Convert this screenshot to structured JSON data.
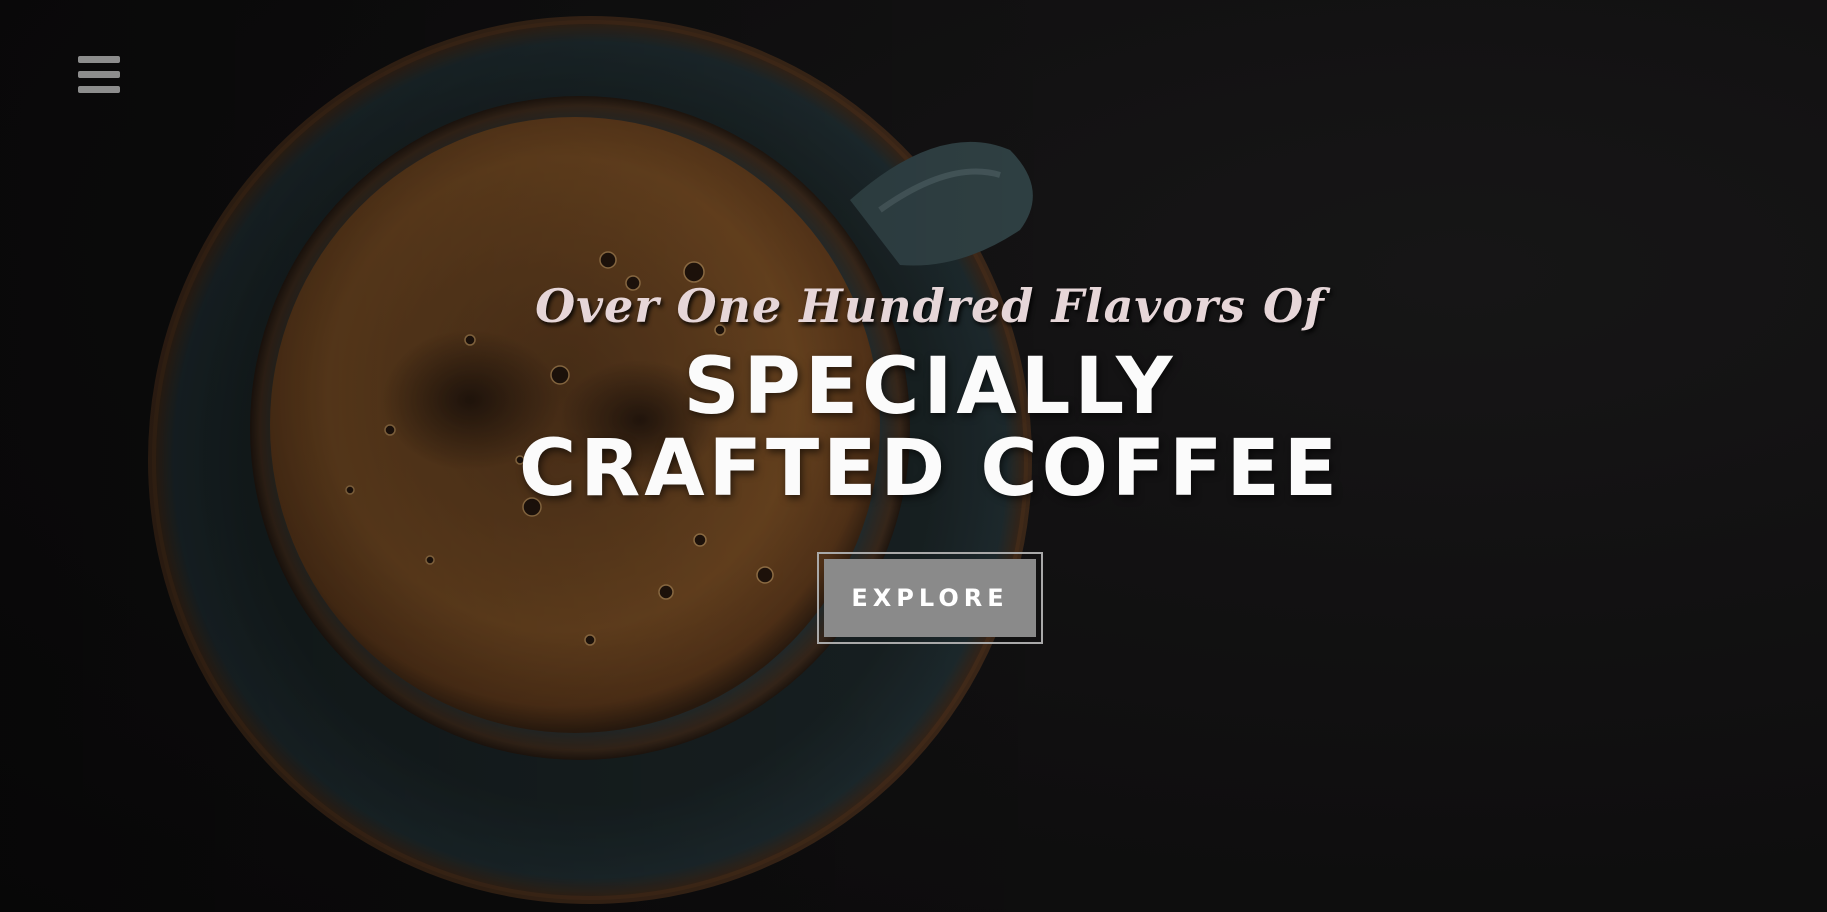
{
  "nav": {
    "menu_icon": "hamburger-menu-icon",
    "menu_color": "#8d8d8d"
  },
  "hero": {
    "background_image": "coffee-cup-on-saucer-top-view",
    "tagline": "Over One Hundred Flavors Of",
    "headline_line1": "SPECIALLY",
    "headline_line2": "CRAFTED COFFEE",
    "cta_label": "EXPLORE",
    "tagline_color": "#e6d6d8",
    "headline_color": "#fbfbfb",
    "cta_background": "#8a8a8a"
  }
}
